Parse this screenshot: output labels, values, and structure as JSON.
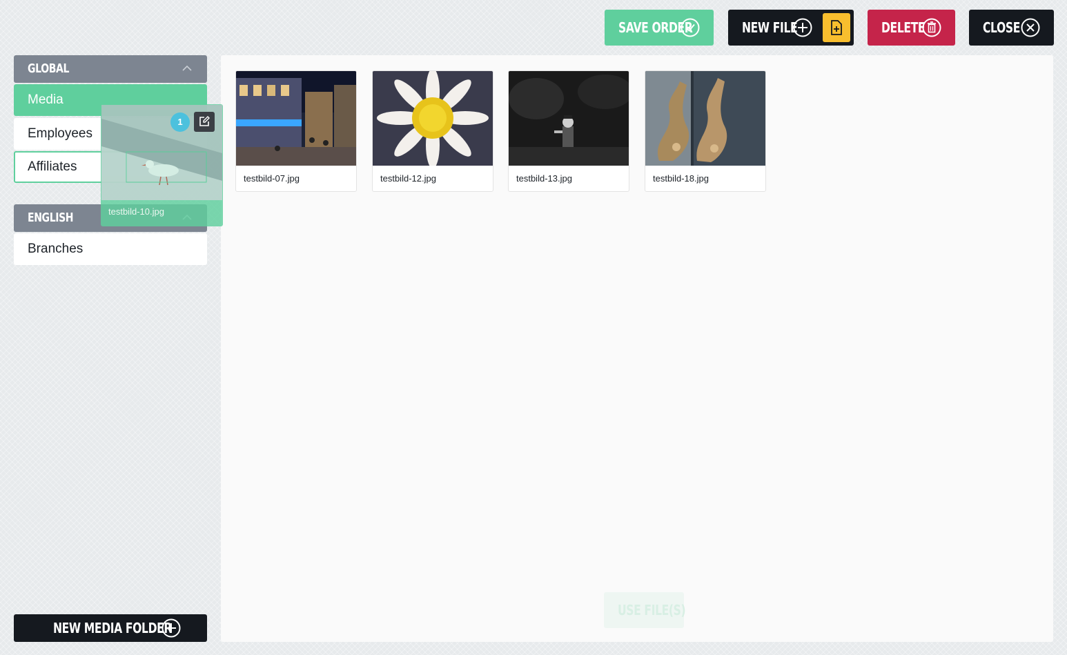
{
  "toolbar": {
    "save_label": "SAVE ORDER",
    "new_file_label": "NEW FILE",
    "delete_label": "DELETE",
    "close_label": "CLOSE"
  },
  "sidebar": {
    "sections": [
      {
        "title": "GLOBAL",
        "items": [
          {
            "label": "Media",
            "active": true
          },
          {
            "label": "Employees"
          },
          {
            "label": "Affiliates",
            "highlighted": true
          }
        ]
      },
      {
        "title": "ENGLISH",
        "items": [
          {
            "label": "Branches"
          }
        ]
      }
    ],
    "new_folder_label": "NEW MEDIA FOLDER"
  },
  "files": [
    {
      "name": "testbild-07.jpg"
    },
    {
      "name": "testbild-12.jpg"
    },
    {
      "name": "testbild-13.jpg"
    },
    {
      "name": "testbild-18.jpg"
    }
  ],
  "dragged_file": {
    "name": "testbild-10.jpg",
    "badge": "1"
  },
  "use_files_label": "USE FILE(S)",
  "colors": {
    "green": "#5fcf9d",
    "dark": "#15191f",
    "red": "#c5244a",
    "yellow": "#f8be2e",
    "header_gray": "#7d8591",
    "badge_blue": "#4cc1dd"
  },
  "icons": {
    "save": "check-circle-icon",
    "new_file": "plus-circle-icon",
    "new_file_doc": "file-plus-icon",
    "delete": "trash-circle-icon",
    "close": "x-circle-icon",
    "collapse": "chevron-up-icon",
    "new_folder": "plus-circle-icon",
    "edit": "edit-icon"
  }
}
